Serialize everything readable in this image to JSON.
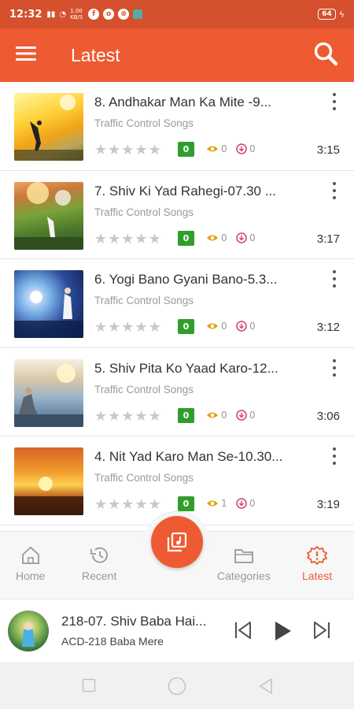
{
  "status": {
    "time": "12:32",
    "net_speed": "1.00 KB/S",
    "battery": "64"
  },
  "appbar": {
    "title": "Latest",
    "menu_icon": "hamburger-menu-icon",
    "search_icon": "search-icon"
  },
  "tracks": [
    {
      "title": "8. Andhakar Man Ka Mite -9...",
      "subtitle": "Traffic Control Songs",
      "rating": 0,
      "rating_badge": "0",
      "views": "0",
      "downloads": "0",
      "duration": "3:15"
    },
    {
      "title": "7. Shiv Ki Yad Rahegi-07.30 ...",
      "subtitle": "Traffic Control Songs",
      "rating": 0,
      "rating_badge": "0",
      "views": "0",
      "downloads": "0",
      "duration": "3:17"
    },
    {
      "title": "6. Yogi Bano Gyani Bano-5.3...",
      "subtitle": "Traffic Control Songs",
      "rating": 0,
      "rating_badge": "0",
      "views": "0",
      "downloads": "0",
      "duration": "3:12"
    },
    {
      "title": "5. Shiv Pita Ko Yaad Karo-12...",
      "subtitle": "Traffic Control Songs",
      "rating": 0,
      "rating_badge": "0",
      "views": "0",
      "downloads": "0",
      "duration": "3:06"
    },
    {
      "title": "4. Nit Yad Karo Man Se-10.30...",
      "subtitle": "Traffic Control Songs",
      "rating": 0,
      "rating_badge": "0",
      "views": "1",
      "downloads": "0",
      "duration": "3:19"
    }
  ],
  "bottom_nav": {
    "items": [
      {
        "label": "Home",
        "icon": "home-icon",
        "active": false
      },
      {
        "label": "Recent",
        "icon": "history-icon",
        "active": false
      },
      {
        "label": "Categories",
        "icon": "folder-icon",
        "active": false
      },
      {
        "label": "Latest",
        "icon": "new-badge-icon",
        "active": true
      }
    ],
    "center_icon": "music-library-icon"
  },
  "player": {
    "title": "218-07. Shiv Baba Hai...",
    "album": "ACD-218 Baba Mere",
    "prev_icon": "skip-previous-icon",
    "play_icon": "play-icon",
    "next_icon": "skip-next-icon"
  },
  "colors": {
    "primary": "#ee5a32",
    "status_bar": "#d5502d",
    "badge_green": "#2f9e2c",
    "views_icon": "#e0a100",
    "download_icon": "#d63d6b"
  }
}
